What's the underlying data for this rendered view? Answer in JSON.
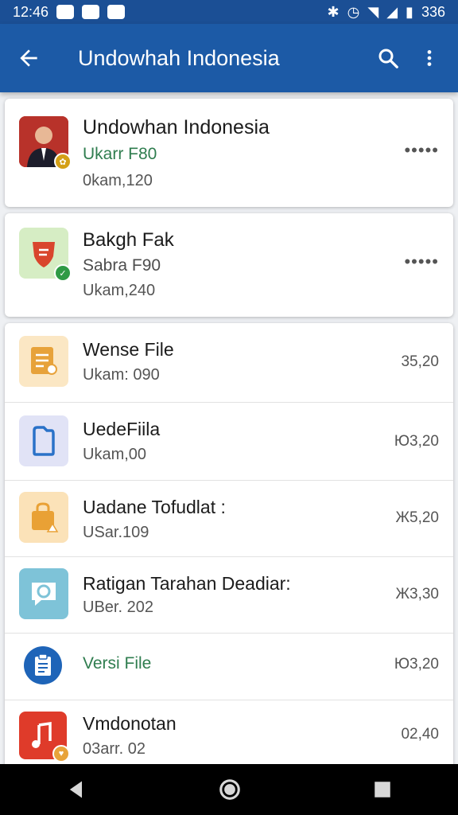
{
  "status_bar": {
    "time": "12:46",
    "battery": "336"
  },
  "app_bar": {
    "title": "Undowhah Indonesia",
    "back_icon": "arrow-left-icon",
    "search_icon": "search-icon",
    "more_icon": "more-vert-icon"
  },
  "cards": [
    {
      "title": "Undowhan Indonesia",
      "subtitle": "Ukarr F80",
      "detail": "0kam,120",
      "menu": "•••••"
    },
    {
      "title": "Bakgh Fak",
      "subtitle": "Sabra F90",
      "detail": "Ukam,240",
      "menu": "•••••"
    }
  ],
  "list": [
    {
      "title": "Wense File",
      "subtitle": "Ukam: 090",
      "amount": "35,20",
      "icon": "document-icon"
    },
    {
      "title": "UedeFiila",
      "subtitle": "Ukam,00",
      "amount": "Ю3,20",
      "icon": "phone-icon"
    },
    {
      "title": "Uadane Tofudlat :",
      "subtitle": "USar.109",
      "amount": "Ж5,20",
      "icon": "bag-icon"
    },
    {
      "title": "Ratigan Tarahan Deadiar:",
      "subtitle": "UBer. 202",
      "amount": "Ж3,30",
      "icon": "chat-icon"
    },
    {
      "title": "Versi File",
      "subtitle": "",
      "amount": "Ю3,20",
      "icon": "clipboard-icon"
    },
    {
      "title": "Vmdonotan",
      "subtitle": "03arr. 02",
      "amount": "02,40",
      "icon": "music-icon"
    }
  ],
  "colors": {
    "app_bar": "#1c5aa6",
    "status_bar": "#1b4f95",
    "accent_green": "#2f7d4f"
  }
}
